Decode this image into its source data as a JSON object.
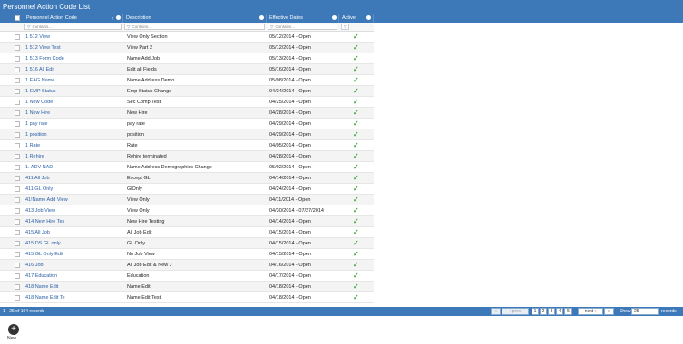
{
  "window": {
    "title": "Personnel Action Code List"
  },
  "columns": {
    "code": "Personnel Action Code",
    "description": "Description",
    "dates": "Effective Dates",
    "active": "Active"
  },
  "filters": {
    "placeholder": "Contains..."
  },
  "rows": [
    {
      "code": "1 512 View",
      "desc": "View Only Section",
      "dates": "05/12/2014 - Open"
    },
    {
      "code": "1 512 View Test",
      "desc": "View Part 2",
      "dates": "05/12/2014 - Open"
    },
    {
      "code": "1 513 Form Code",
      "desc": "Name Add Job",
      "dates": "05/13/2014 - Open"
    },
    {
      "code": "1 516 All Edit",
      "desc": "Edit all Fields",
      "dates": "05/16/2014 - Open"
    },
    {
      "code": "1 EAG Name",
      "desc": "Name Address Demo",
      "dates": "05/08/2014 - Open"
    },
    {
      "code": "1 EMP Status",
      "desc": "Emp Status Change",
      "dates": "04/24/2014 - Open"
    },
    {
      "code": "1 New Code",
      "desc": "Sec Comp Test",
      "dates": "04/25/2014 - Open"
    },
    {
      "code": "1 New Hire",
      "desc": "New Hire",
      "dates": "04/28/2014 - Open"
    },
    {
      "code": "1 pay rate",
      "desc": "pay rate",
      "dates": "04/29/2014 - Open"
    },
    {
      "code": "1 position",
      "desc": "position",
      "dates": "04/29/2014 - Open"
    },
    {
      "code": "1 Rate",
      "desc": "Rate",
      "dates": "04/05/2014 - Open"
    },
    {
      "code": "1 Rehire",
      "desc": "Rehire terminated",
      "dates": "04/28/2014 - Open"
    },
    {
      "code": "1. ADV NAD",
      "desc": "Name Address Demographics Change",
      "dates": "05/02/2014 - Open"
    },
    {
      "code": "411 All Job",
      "desc": "Except GL",
      "dates": "04/14/2014 - Open"
    },
    {
      "code": "411 GL Only",
      "desc": "GlOnly",
      "dates": "04/24/2014 - Open"
    },
    {
      "code": "41!Name Add View",
      "desc": "View Only",
      "dates": "04/11/2014 - Open"
    },
    {
      "code": "413 Job View",
      "desc": "View Only",
      "dates": "04/30/2014 - 07/27/2014"
    },
    {
      "code": "414 New Hire Tes",
      "desc": "New Hire Testing",
      "dates": "04/14/2014 - Open"
    },
    {
      "code": "415 All Job",
      "desc": "All Job Edit",
      "dates": "04/15/2014 - Open"
    },
    {
      "code": "415 DS GL only",
      "desc": "GL Only",
      "dates": "04/15/2014 - Open"
    },
    {
      "code": "415 GL Only Edit",
      "desc": "No Job View",
      "dates": "04/15/2014 - Open"
    },
    {
      "code": "416 Job",
      "desc": "All Job Edit & New J",
      "dates": "04/16/2014 - Open"
    },
    {
      "code": "417 Education",
      "desc": "Education",
      "dates": "04/17/2014 - Open"
    },
    {
      "code": "418 Name Edit",
      "desc": "Name Edit",
      "dates": "04/18/2014 - Open"
    },
    {
      "code": "418 Name Edit Te",
      "desc": "Name Edit Test",
      "dates": "04/18/2014 - Open"
    }
  ],
  "active_mark": "✓",
  "footer": {
    "records": "1 - 25 of 104 records",
    "first": "«",
    "prev": "‹ prev",
    "pages": [
      "1",
      "2",
      "3",
      "4",
      "5"
    ],
    "next": "next ›",
    "last": "»",
    "show_label": "Show",
    "page_size": "25",
    "records_label": "records"
  },
  "actions": {
    "new_label": "New",
    "new_icon": "plus-circle-icon"
  },
  "colors": {
    "accent": "#3d79b8",
    "link": "#2a5fa5",
    "check": "#3aaa35"
  }
}
